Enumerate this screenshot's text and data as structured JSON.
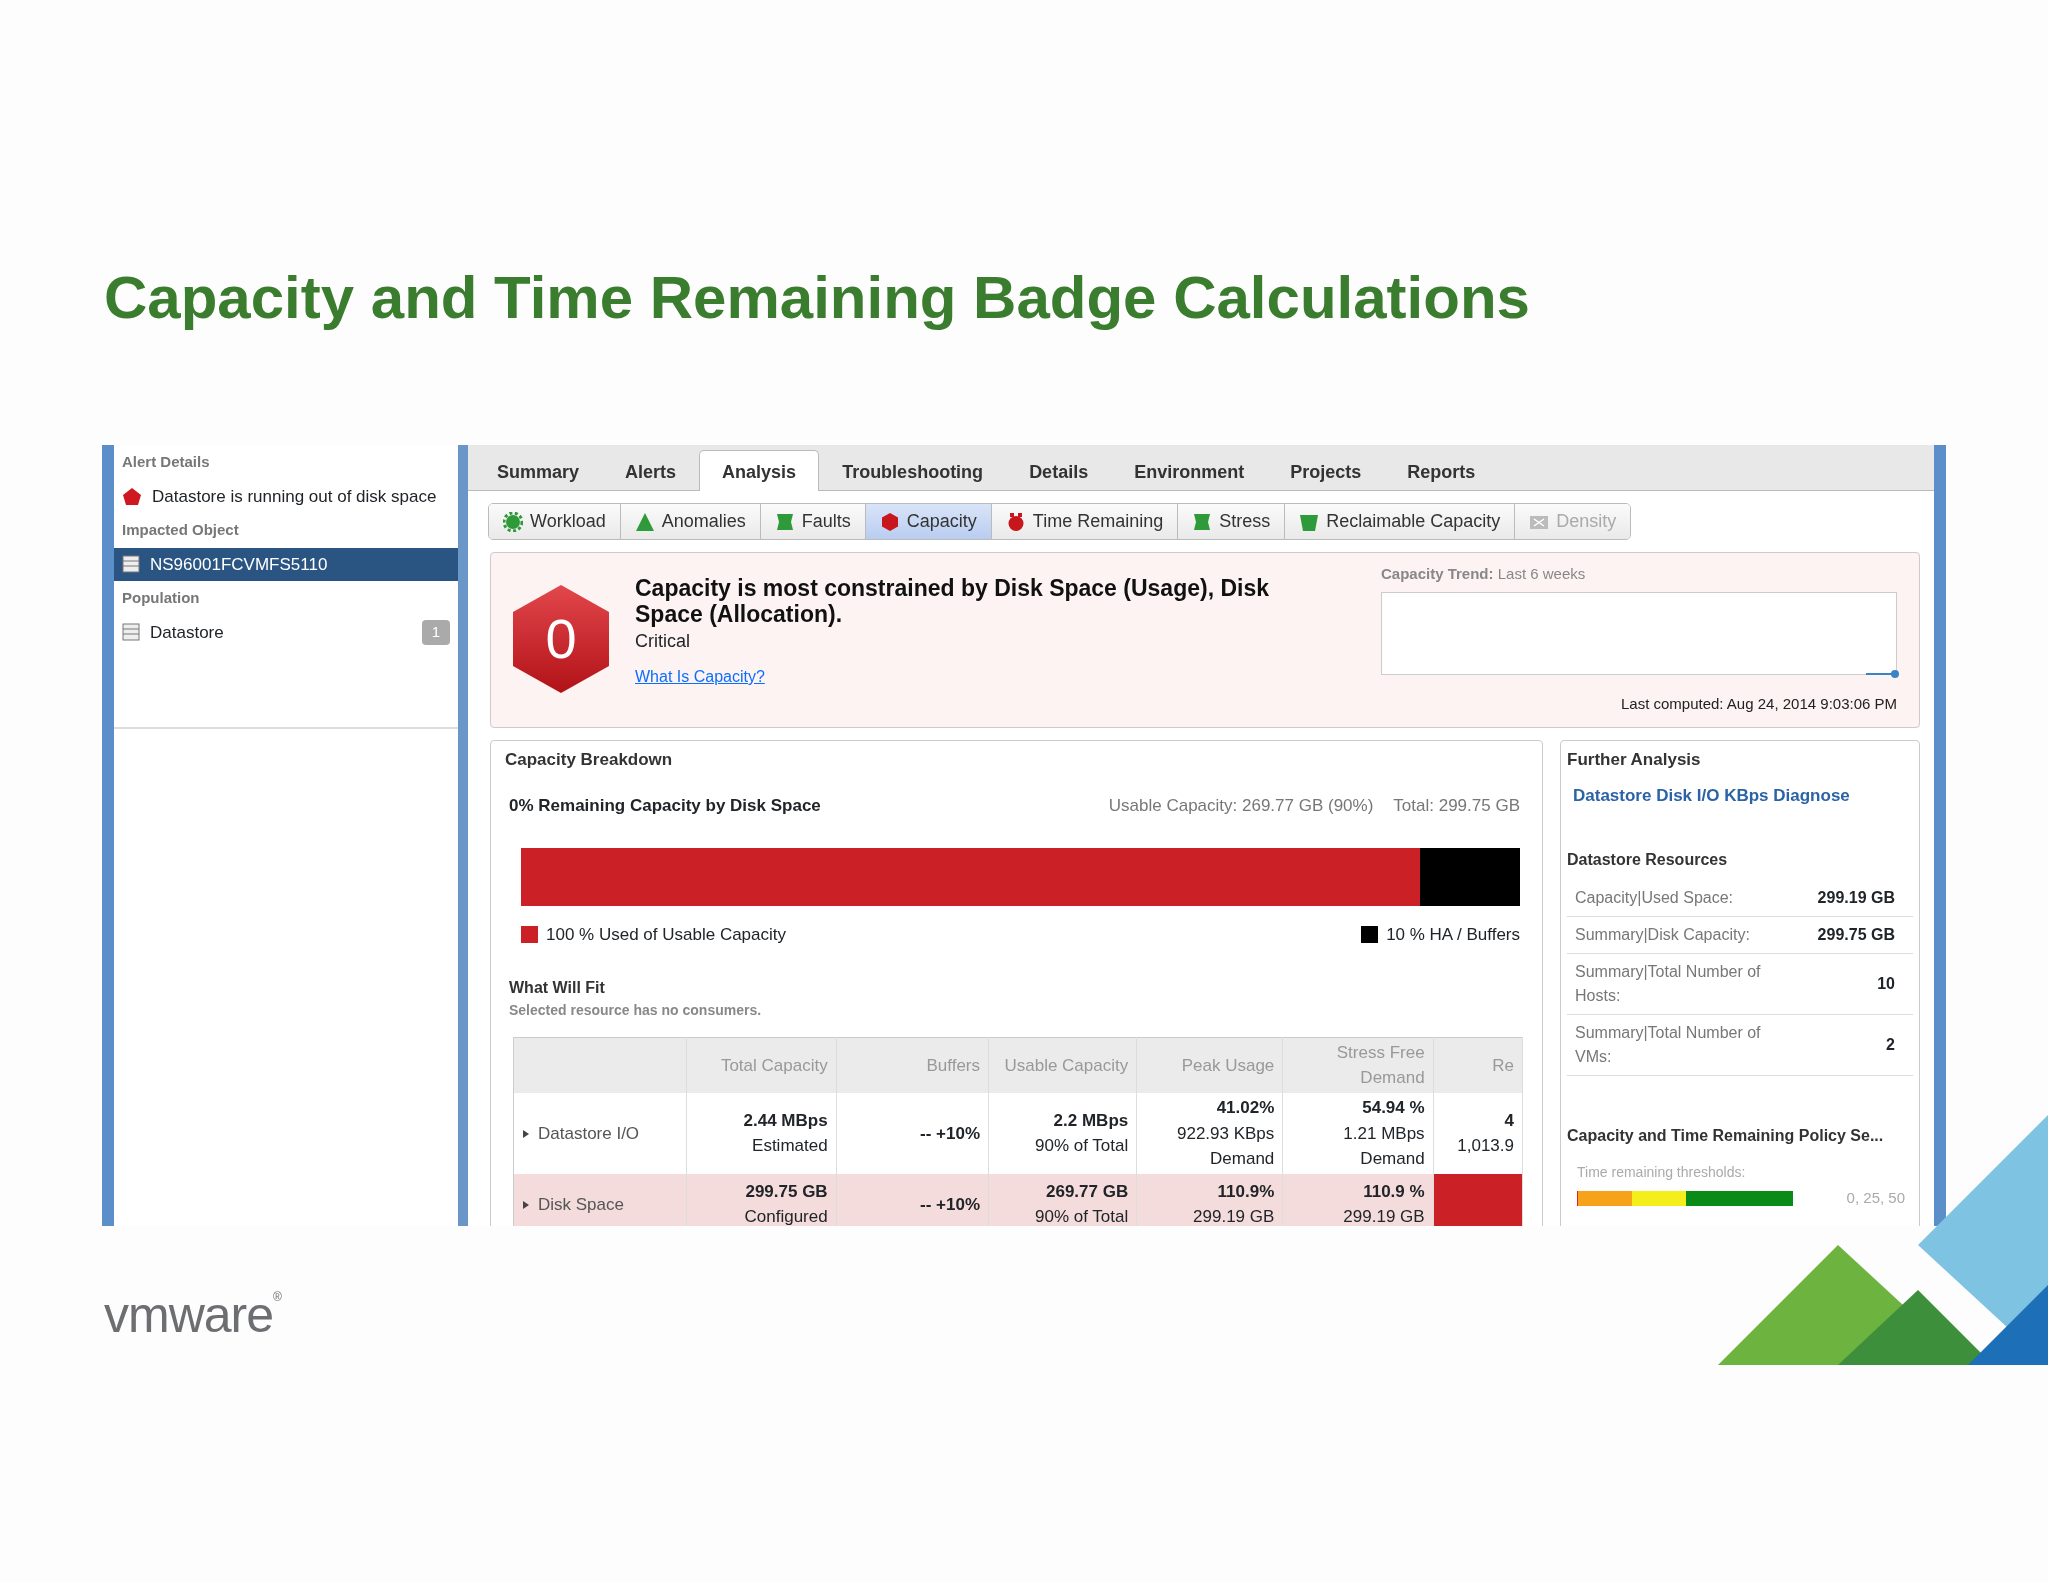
{
  "slide_title": "Capacity and Time Remaining Badge Calculations",
  "left_panel": {
    "alert_heading": "Alert Details",
    "alert": "Datastore is running out of disk space",
    "impacted_heading": "Impacted Object",
    "impacted_object": {
      "label": "NS96001FCVMFS5110",
      "selected": true
    },
    "population_heading": "Population",
    "population": [
      {
        "label": "Datastore",
        "count": "1",
        "selected": false
      }
    ]
  },
  "tabs": [
    {
      "label": "Summary",
      "selected": false
    },
    {
      "label": "Alerts",
      "selected": false
    },
    {
      "label": "Analysis",
      "selected": true
    },
    {
      "label": "Troubleshooting",
      "selected": false
    },
    {
      "label": "Details",
      "selected": false
    },
    {
      "label": "Environment",
      "selected": false
    },
    {
      "label": "Projects",
      "selected": false
    },
    {
      "label": "Reports",
      "selected": false
    }
  ],
  "sub_tabs": [
    {
      "label": "Workload",
      "kind": "gear",
      "selected": false,
      "disabled": false
    },
    {
      "label": "Anomalies",
      "kind": "triangle",
      "selected": false,
      "disabled": false
    },
    {
      "label": "Faults",
      "kind": "banner",
      "selected": false,
      "disabled": false
    },
    {
      "label": "Capacity",
      "kind": "hexagon",
      "selected": true,
      "disabled": false
    },
    {
      "label": "Time Remaining",
      "kind": "timer",
      "selected": false,
      "disabled": false
    },
    {
      "label": "Stress",
      "kind": "banner",
      "selected": false,
      "disabled": false
    },
    {
      "label": "Reclaimable Capacity",
      "kind": "bucket",
      "selected": false,
      "disabled": false
    },
    {
      "label": "Density",
      "kind": "envelope",
      "selected": false,
      "disabled": true
    }
  ],
  "badge": {
    "value": "0",
    "headline": "Capacity is most constrained by Disk Space (Usage), Disk Space (Allocation).",
    "severity": "Critical",
    "link": "What Is Capacity?",
    "trend_label": "Capacity Trend:",
    "trend_period": "Last 6 weeks",
    "last_computed": "Last computed: Aug 24, 2014 9:03:06 PM"
  },
  "capacity_breakdown": {
    "title": "Capacity Breakdown",
    "subtitle": "0% Remaining Capacity by Disk Space",
    "usable": "Usable Capacity: 269.77 GB (90%)",
    "total": "Total: 299.75 GB",
    "level": 0.9,
    "legend": [
      {
        "label": "100 % Used of Usable Capacity",
        "color": "#cc2027"
      },
      {
        "label": "10 % HA / Buffers",
        "color": "#000000"
      }
    ],
    "fit_title": "What Will Fit",
    "fit_note": "Selected resource has no consumers.",
    "columns": [
      "Total Capacity",
      "Buffers",
      "Usable Capacity",
      "Peak Usage",
      "Stress Free Demand",
      "Re"
    ],
    "rows": [
      {
        "name": "Datastore I/O",
        "highlighted": false,
        "cells": [
          [
            "2.44 MBps",
            "Estimated"
          ],
          [
            "-- +10%"
          ],
          [
            "2.2 MBps",
            "90% of Total"
          ],
          [
            "41.02%",
            "922.93 KBps",
            "Demand"
          ],
          [
            "54.94 %",
            "1.21 MBps",
            "Demand"
          ],
          [
            "4",
            "1,013.9"
          ]
        ]
      },
      {
        "name": "Disk Space",
        "highlighted": true,
        "cells": [
          [
            "299.75 GB",
            "Configured"
          ],
          [
            "-- +10%"
          ],
          [
            "269.77 GB",
            "90% of Total"
          ],
          [
            "110.9%",
            "299.19 GB"
          ],
          [
            "110.9 %",
            "299.19 GB"
          ]
        ]
      }
    ]
  },
  "further_analysis": {
    "title": "Further Analysis",
    "link": "Datastore Disk I/O KBps Diagnose",
    "resources_title": "Datastore Resources",
    "resources": [
      {
        "label": "Capacity|Used Space:",
        "value": "299.19 GB"
      },
      {
        "label": "Summary|Disk Capacity:",
        "value": "299.75 GB"
      },
      {
        "label": "Summary|Total Number of Hosts:",
        "value": "10"
      },
      {
        "label": "Summary|Total Number of VMs:",
        "value": "2"
      }
    ],
    "policy_title": "Capacity and Time Remaining Policy Se...",
    "thresholds_label": "Time remaining thresholds:",
    "thresholds_value": "0, 25, 50"
  },
  "logo": "vmware$^{®}$"
}
